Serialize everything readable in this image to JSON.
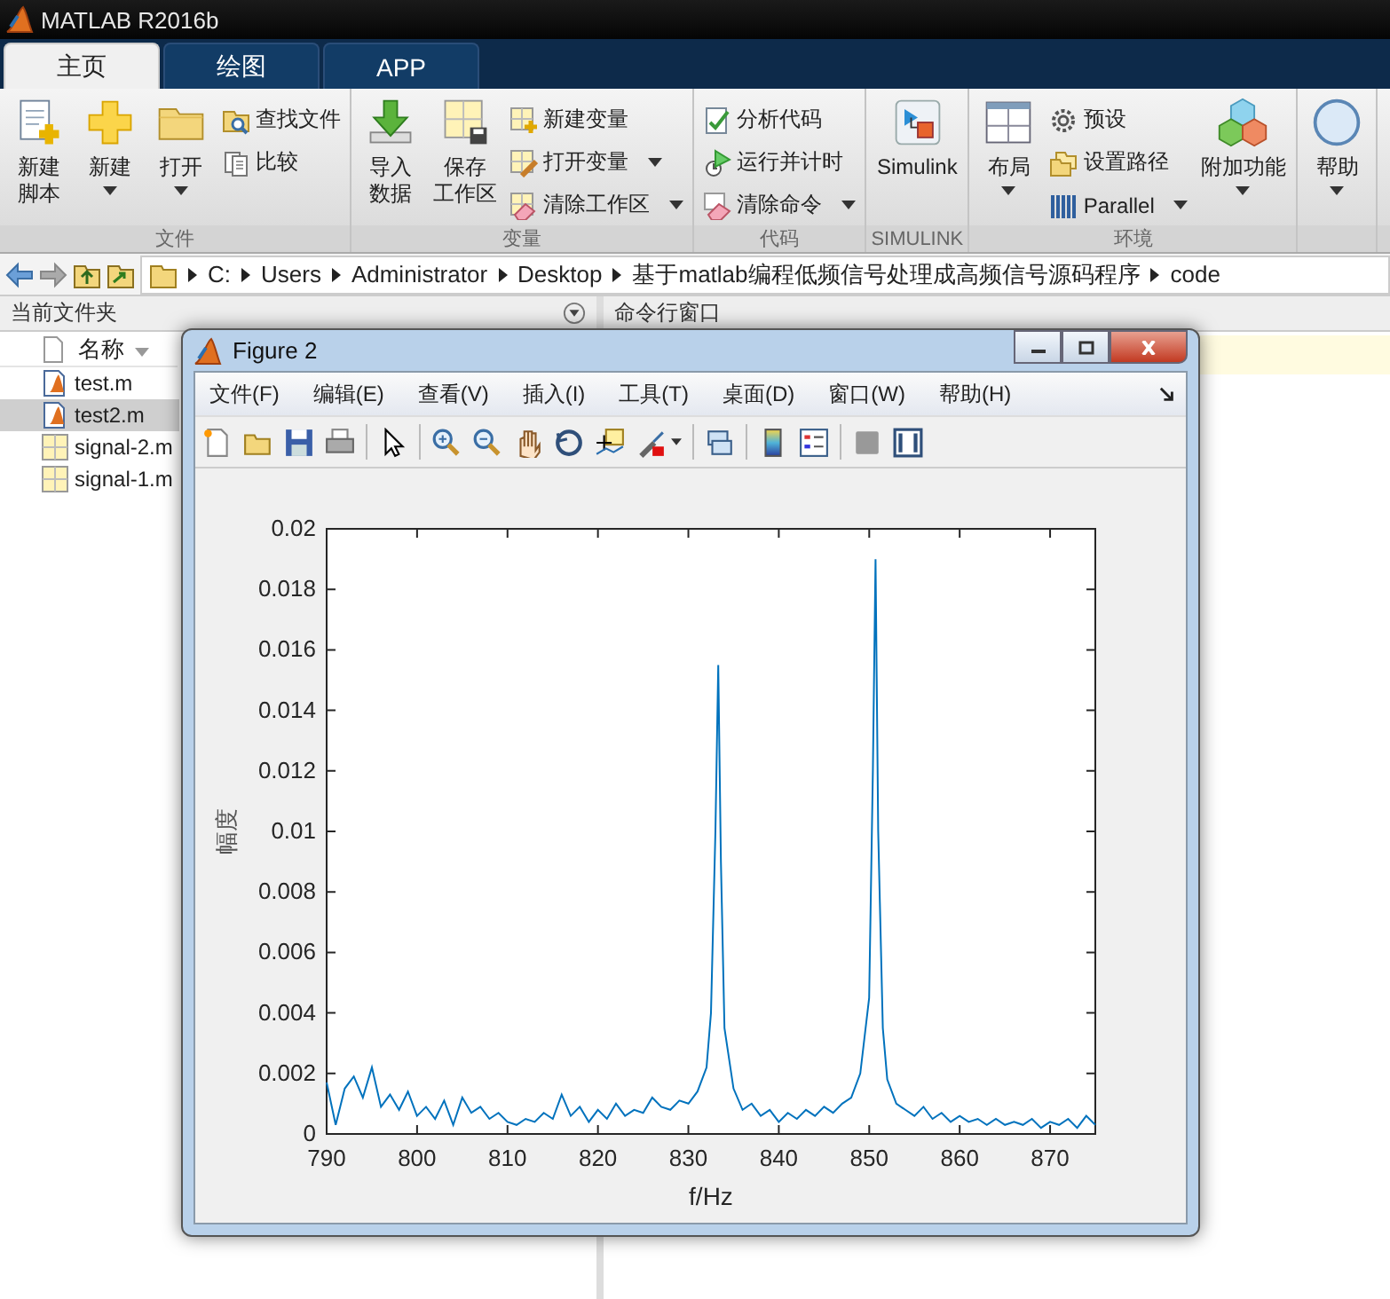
{
  "app_window": {
    "title": "MATLAB R2016b"
  },
  "tabs": [
    {
      "label": "主页",
      "selected": true
    },
    {
      "label": "绘图",
      "selected": false
    },
    {
      "label": "APP",
      "selected": false
    }
  ],
  "ribbon": {
    "groups": [
      {
        "label": "文件",
        "items": [
          {
            "kind": "large",
            "lines": [
              "新建",
              "脚本"
            ],
            "dropdown": false
          },
          {
            "kind": "large",
            "lines": [
              "新建"
            ],
            "dropdown": true
          },
          {
            "kind": "large",
            "lines": [
              "打开"
            ],
            "dropdown": true
          },
          {
            "kind": "small",
            "lines": [
              "查找文件"
            ],
            "dropdown": false
          },
          {
            "kind": "small",
            "lines": [
              "比较"
            ],
            "dropdown": false
          }
        ]
      },
      {
        "label": "变量",
        "items": [
          {
            "kind": "large",
            "lines": [
              "导入",
              "数据"
            ],
            "dropdown": false
          },
          {
            "kind": "large",
            "lines": [
              "保存",
              "工作区"
            ],
            "dropdown": false
          },
          {
            "kind": "small",
            "lines": [
              "新建变量"
            ],
            "dropdown": false
          },
          {
            "kind": "small",
            "lines": [
              "打开变量"
            ],
            "dropdown": true
          },
          {
            "kind": "small",
            "lines": [
              "清除工作区"
            ],
            "dropdown": true
          }
        ]
      },
      {
        "label": "代码",
        "items": [
          {
            "kind": "small",
            "lines": [
              "分析代码"
            ],
            "dropdown": false
          },
          {
            "kind": "small",
            "lines": [
              "运行并计时"
            ],
            "dropdown": false
          },
          {
            "kind": "small",
            "lines": [
              "清除命令"
            ],
            "dropdown": true
          }
        ]
      },
      {
        "label": "SIMULINK",
        "items": [
          {
            "kind": "large",
            "lines": [
              "Simulink"
            ],
            "dropdown": false
          }
        ]
      },
      {
        "label": "环境",
        "items": [
          {
            "kind": "large",
            "lines": [
              "布局"
            ],
            "dropdown": true
          },
          {
            "kind": "small",
            "lines": [
              "预设"
            ],
            "dropdown": false
          },
          {
            "kind": "small",
            "lines": [
              "设置路径"
            ],
            "dropdown": false
          },
          {
            "kind": "small",
            "lines": [
              "Parallel"
            ],
            "dropdown": true
          },
          {
            "kind": "large",
            "lines": [
              "附加功能"
            ],
            "dropdown": true
          }
        ]
      },
      {
        "items": [
          {
            "kind": "large",
            "lines": [
              "帮助"
            ],
            "dropdown": true
          }
        ]
      }
    ]
  },
  "address_bar": {
    "crumbs": [
      "C:",
      "Users",
      "Administrator",
      "Desktop",
      "基于matlab编程低频信号处理成高频信号源码程序",
      "code"
    ]
  },
  "current_folder": {
    "title": "当前文件夹",
    "column": "名称",
    "files": [
      {
        "name": "test.m",
        "kind": "script",
        "selected": false
      },
      {
        "name": "test2.m",
        "kind": "script",
        "selected": true
      },
      {
        "name": "signal-2.m",
        "kind": "data",
        "selected": false
      },
      {
        "name": "signal-1.m",
        "kind": "data",
        "selected": false
      }
    ]
  },
  "command_window": {
    "title": "命令行窗口"
  },
  "figure_window": {
    "title": "Figure 2",
    "menu": [
      "文件(F)",
      "编辑(E)",
      "查看(V)",
      "插入(I)",
      "工具(T)",
      "桌面(D)",
      "窗口(W)",
      "帮助(H)"
    ],
    "chart_data": {
      "type": "line",
      "xlabel": "f/Hz",
      "ylabel": "幅度",
      "xlim": [
        790,
        875
      ],
      "ylim": [
        0,
        0.02
      ],
      "xticks": [
        790,
        800,
        810,
        820,
        830,
        840,
        850,
        860,
        870
      ],
      "yticks": [
        0,
        0.002,
        0.004,
        0.006,
        0.008,
        0.01,
        0.012,
        0.014,
        0.016,
        0.018,
        0.02
      ],
      "x": [
        790,
        791,
        792,
        793,
        794,
        795,
        796,
        797,
        798,
        799,
        800,
        801,
        802,
        803,
        804,
        805,
        806,
        807,
        808,
        809,
        810,
        811,
        812,
        813,
        814,
        815,
        816,
        817,
        818,
        819,
        820,
        821,
        822,
        823,
        824,
        825,
        826,
        827,
        828,
        829,
        830,
        831,
        832,
        832.5,
        833,
        833.3,
        833.6,
        834,
        835,
        836,
        837,
        838,
        839,
        840,
        841,
        842,
        843,
        844,
        845,
        846,
        847,
        848,
        849,
        850,
        850.4,
        850.7,
        851,
        851.5,
        852,
        853,
        854,
        855,
        856,
        857,
        858,
        859,
        860,
        861,
        862,
        863,
        864,
        865,
        866,
        867,
        868,
        869,
        870,
        871,
        872,
        873,
        874,
        875
      ],
      "series": [
        {
          "color": "#0072bd",
          "values": [
            0.0017,
            0.0003,
            0.0015,
            0.0019,
            0.0012,
            0.0022,
            0.0009,
            0.0013,
            0.0008,
            0.0014,
            0.0006,
            0.0009,
            0.0005,
            0.0011,
            0.0003,
            0.0012,
            0.0007,
            0.0009,
            0.0005,
            0.0007,
            0.0004,
            0.0003,
            0.0005,
            0.0004,
            0.0007,
            0.0005,
            0.0013,
            0.0006,
            0.0009,
            0.0004,
            0.0008,
            0.0005,
            0.001,
            0.0006,
            0.0008,
            0.0007,
            0.0012,
            0.0009,
            0.0008,
            0.0011,
            0.001,
            0.0014,
            0.0022,
            0.004,
            0.01,
            0.0155,
            0.009,
            0.0035,
            0.0015,
            0.0008,
            0.001,
            0.0006,
            0.0008,
            0.0004,
            0.0007,
            0.0005,
            0.0008,
            0.0006,
            0.0009,
            0.0007,
            0.001,
            0.0012,
            0.002,
            0.0045,
            0.012,
            0.019,
            0.01,
            0.0035,
            0.0018,
            0.001,
            0.0008,
            0.0006,
            0.0009,
            0.0005,
            0.0007,
            0.0004,
            0.0006,
            0.0004,
            0.0005,
            0.0003,
            0.0005,
            0.0003,
            0.0004,
            0.0003,
            0.0005,
            0.0002,
            0.0004,
            0.0003,
            0.0005,
            0.0002,
            0.0006,
            0.0003
          ]
        }
      ]
    }
  }
}
